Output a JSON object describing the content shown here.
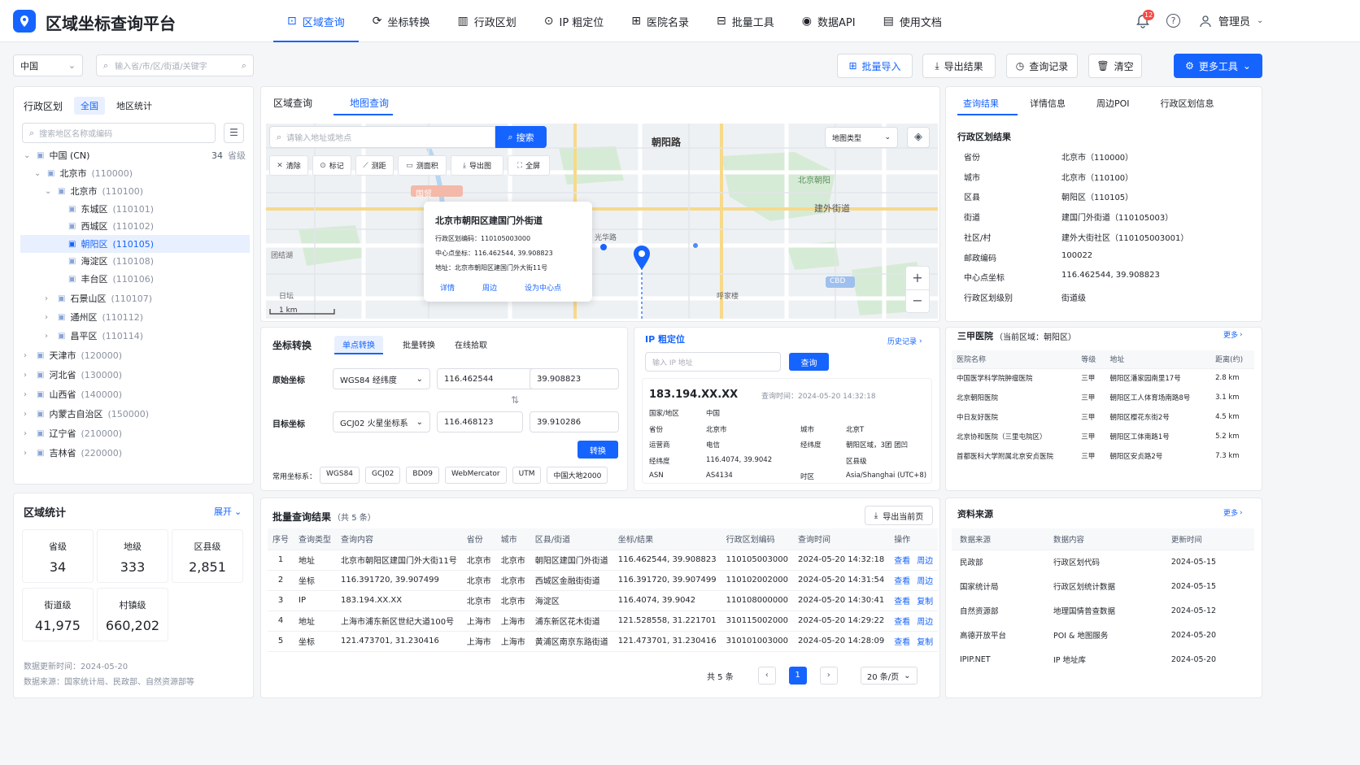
{
  "app": {
    "title": "区域坐标查询平台",
    "accent": "#1664ff"
  },
  "nav": [
    {
      "label": "区域查询",
      "icon": "cube-icon",
      "active": true
    },
    {
      "label": "坐标转换",
      "icon": "refresh-icon"
    },
    {
      "label": "行政区划",
      "icon": "building-icon"
    },
    {
      "label": "IP 粗定位",
      "icon": "pin-icon"
    },
    {
      "label": "医院名录",
      "icon": "hospital-icon"
    },
    {
      "label": "批量工具",
      "icon": "tool-icon"
    },
    {
      "label": "数据API",
      "icon": "api-icon"
    },
    {
      "label": "使用文档",
      "icon": "doc-icon"
    }
  ],
  "header": {
    "notif_count": "12",
    "user": "管理员"
  },
  "toolbar": {
    "country": "中国",
    "search_placeholder": "输入省/市/区/街道/关键字",
    "import": "批量导入",
    "export": "导出结果",
    "history": "查询记录",
    "clear": "清空",
    "more": "更多工具"
  },
  "left": {
    "tabs": [
      "行政区划",
      "全国",
      "地区统计"
    ],
    "search_placeholder": "搜索地区名称或编码",
    "tree": [
      {
        "label": "中国 (CN)",
        "code": "",
        "count": "34",
        "unit": "省级",
        "level": 0,
        "exp": "open"
      },
      {
        "label": "北京市",
        "code": "(110000)",
        "level": 1,
        "exp": "open"
      },
      {
        "label": "北京市",
        "code": "(110100)",
        "level": 2,
        "exp": "open"
      },
      {
        "label": "东城区",
        "code": "(110101)",
        "level": 3
      },
      {
        "label": "西城区",
        "code": "(110102)",
        "level": 3
      },
      {
        "label": "朝阳区",
        "code": "(110105)",
        "level": 3,
        "selected": true
      },
      {
        "label": "海淀区",
        "code": "(110108)",
        "level": 3
      },
      {
        "label": "丰台区",
        "code": "(110106)",
        "level": 3
      },
      {
        "label": "石景山区",
        "code": "(110107)",
        "level": 2,
        "exp": "closed"
      },
      {
        "label": "通州区",
        "code": "(110112)",
        "level": 2,
        "exp": "closed"
      },
      {
        "label": "昌平区",
        "code": "(110114)",
        "level": 2,
        "exp": "closed"
      },
      {
        "label": "天津市",
        "code": "(120000)",
        "level": 0,
        "exp": "closed"
      },
      {
        "label": "河北省",
        "code": "(130000)",
        "level": 0,
        "exp": "closed"
      },
      {
        "label": "山西省",
        "code": "(140000)",
        "level": 0,
        "exp": "closed"
      },
      {
        "label": "内蒙古自治区",
        "code": "(150000)",
        "level": 0,
        "exp": "closed"
      },
      {
        "label": "辽宁省",
        "code": "(210000)",
        "level": 0,
        "exp": "closed"
      },
      {
        "label": "吉林省",
        "code": "(220000)",
        "level": 0,
        "exp": "closed"
      }
    ]
  },
  "stats": {
    "title": "区域统计",
    "expand": "展开",
    "items": [
      {
        "label": "省级",
        "value": "34"
      },
      {
        "label": "地级",
        "value": "333"
      },
      {
        "label": "区县级",
        "value": "2,851"
      },
      {
        "label": "街道级",
        "value": "41,975"
      },
      {
        "label": "村镇级",
        "value": "660,202"
      }
    ],
    "update": "数据更新时间：2024-05-20",
    "source": "数据来源：国家统计局、民政部、自然资源部等"
  },
  "map": {
    "tabs": [
      "区域查询",
      "地图查询"
    ],
    "search_placeholder": "请输入地址或地点",
    "search_btn": "搜索",
    "type": "地图类型",
    "tools": [
      "清除",
      "标记",
      "测距",
      "测面积",
      "导出图",
      "全屏"
    ],
    "popup": {
      "title": "北京市朝阳区建国门外街道",
      "code": "行政区划编码：110105003000",
      "center": "中心点坐标：116.462544, 39.908823",
      "addr": "地址：北京市朝阳区建国门外大街11号",
      "actions": [
        "详情",
        "周边",
        "设为中心点"
      ]
    },
    "scale": "1 km",
    "labels": [
      "朝阳路",
      "北京朝阳",
      "建外街道",
      "国贸",
      "团结湖",
      "光华路",
      "日坛",
      "呼家楼",
      "CBD"
    ]
  },
  "coord": {
    "title": "坐标转换",
    "tabs": [
      "单点转换",
      "批量转换",
      "在线拾取"
    ],
    "src_label": "原始坐标",
    "src_sys": "WGS84 经纬度",
    "src_lng": "116.462544",
    "src_lat": "39.908823",
    "dst_label": "目标坐标",
    "dst_sys": "GCJ02 火星坐标系",
    "dst_lng": "116.468123",
    "dst_lat": "39.910286",
    "convert": "转换",
    "common_label": "常用坐标系：",
    "common": [
      "WGS84",
      "GCJ02",
      "BD09",
      "WebMercator",
      "UTM",
      "中国大地2000"
    ]
  },
  "ip": {
    "title": "IP 粗定位",
    "history": "历史记录",
    "placeholder": "输入  IP 地址",
    "query": "查询",
    "ip": "183.194.XX.XX",
    "time": "查询时间：2024-05-20 14:32:18",
    "rows": [
      [
        "国家/地区",
        "中国",
        "",
        ""
      ],
      [
        "省份",
        "北京市",
        "城市",
        "北京T"
      ],
      [
        "运营商",
        "电信",
        "经纬度",
        "朝阳区域，3团 团凹"
      ],
      [
        "经纬度",
        "116.4074, 39.9042",
        "",
        "区县级"
      ],
      [
        "ASN",
        "AS4134",
        "时区",
        "Asia/Shanghai (UTC+8)"
      ]
    ]
  },
  "batch": {
    "title": "批量查询结果",
    "count": "（共 5 条）",
    "export": "导出当前页",
    "headers": [
      "序号",
      "查询类型",
      "查询内容",
      "省份",
      "城市",
      "区县/街道",
      "坐标/结果",
      "行政区划编码",
      "查询时间",
      "操作"
    ],
    "rows": [
      [
        "1",
        "地址",
        "北京市朝阳区建国门外大街11号",
        "北京市",
        "北京市",
        "朝阳区建国门外街道",
        "116.462544, 39.908823",
        "110105003000",
        "2024-05-20 14:32:18",
        "查看",
        "周边"
      ],
      [
        "2",
        "坐标",
        "116.391720, 39.907499",
        "北京市",
        "北京市",
        "西城区金融街街道",
        "116.391720, 39.907499",
        "110102002000",
        "2024-05-20 14:31:54",
        "查看",
        "周边"
      ],
      [
        "3",
        "IP",
        "183.194.XX.XX",
        "北京市",
        "北京市",
        "海淀区",
        "116.4074, 39.9042",
        "110108000000",
        "2024-05-20 14:30:41",
        "查看",
        "复制"
      ],
      [
        "4",
        "地址",
        "上海市浦东新区世纪大道100号",
        "上海市",
        "上海市",
        "浦东新区花木街道",
        "121.528558, 31.221701",
        "310115002000",
        "2024-05-20 14:29:22",
        "查看",
        "周边"
      ],
      [
        "5",
        "坐标",
        "121.473701, 31.230416",
        "上海市",
        "上海市",
        "黄浦区南京东路街道",
        "121.473701, 31.230416",
        "310101003000",
        "2024-05-20 14:28:09",
        "查看",
        "复制"
      ]
    ],
    "total": "共 5 条",
    "page": "1",
    "page_size": "20 条/页"
  },
  "right": {
    "tabs": [
      "查询结果",
      "详情信息",
      "周边POI",
      "行政区划信息"
    ],
    "admin_title": "行政区划结果",
    "admin": [
      [
        "省份",
        "北京市（110000）"
      ],
      [
        "城市",
        "北京市（110100）"
      ],
      [
        "区县",
        "朝阳区（110105）"
      ],
      [
        "街道",
        "建国门外街道（110105003）"
      ],
      [
        "社区/村",
        "建外大街社区（110105003001）"
      ],
      [
        "邮政编码",
        "100022"
      ],
      [
        "中心点坐标",
        "116.462544, 39.908823"
      ],
      [
        "行政区划级别",
        "街道级"
      ]
    ],
    "hosp_title": "三甲医院",
    "hosp_sub": "（当前区域：朝阳区）",
    "more": "更多",
    "hosp_headers": [
      "医院名称",
      "等级",
      "地址",
      "距离(约)"
    ],
    "hosp": [
      [
        "中国医学科学院肿瘤医院",
        "三甲",
        "朝阳区潘家园南里17号",
        "2.8 km"
      ],
      [
        "北京朝阳医院",
        "三甲",
        "朝阳区工人体育场南路8号",
        "3.1 km"
      ],
      [
        "中日友好医院",
        "三甲",
        "朝阳区樱花东街2号",
        "4.5 km"
      ],
      [
        "北京协和医院（三里屯院区）",
        "三甲",
        "朝阳区工体南路1号",
        "5.2 km"
      ],
      [
        "首都医科大学附属北京安贞医院",
        "三甲",
        "朝阳区安贞路2号",
        "7.3 km"
      ]
    ],
    "src_title": "资料来源",
    "src_headers": [
      "数据来源",
      "数据内容",
      "更新时间"
    ],
    "src": [
      [
        "民政部",
        "行政区划代码",
        "2024-05-15"
      ],
      [
        "国家统计局",
        "行政区划统计数据",
        "2024-05-15"
      ],
      [
        "自然资源部",
        "地理国情普查数据",
        "2024-05-12"
      ],
      [
        "高德开放平台",
        "POI & 地图服务",
        "2024-05-20"
      ],
      [
        "IPIP.NET",
        "IP 地址库",
        "2024-05-20"
      ]
    ]
  }
}
